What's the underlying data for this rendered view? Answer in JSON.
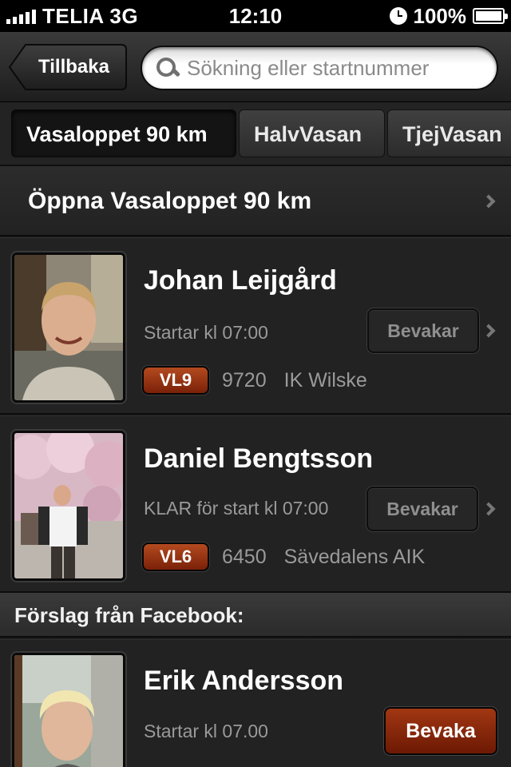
{
  "status_bar": {
    "carrier": "TELIA 3G",
    "time": "12:10",
    "battery": "100%",
    "signal_bars": 5
  },
  "nav": {
    "back_label": "Tillbaka",
    "search_placeholder": "Sökning eller startnummer"
  },
  "tabs": [
    {
      "label": "Vasaloppet 90 km",
      "active": true
    },
    {
      "label": "HalvVasan",
      "active": false
    },
    {
      "label": "TjejVasan",
      "active": false
    }
  ],
  "event": {
    "title": "Öppna Vasaloppet 90 km"
  },
  "athletes": [
    {
      "name": "Johan Leijgård",
      "start": "Startar kl 07:00",
      "badge": "VL9",
      "number": "9720",
      "club": "IK Wilske",
      "button": "Bevakar"
    },
    {
      "name": "Daniel Bengtsson",
      "start": "KLAR för start kl 07:00",
      "badge": "VL6",
      "number": "6450",
      "club": "Sävedalens AIK",
      "button": "Bevakar"
    }
  ],
  "facebook_section": {
    "header": "Förslag från Facebook:",
    "athletes": [
      {
        "name": "Erik Andersson",
        "start": "Startar kl 07.00",
        "button": "Bevaka"
      }
    ]
  },
  "colors": {
    "accent_red": "#8a2a0c",
    "background": "#1c1c1c"
  }
}
